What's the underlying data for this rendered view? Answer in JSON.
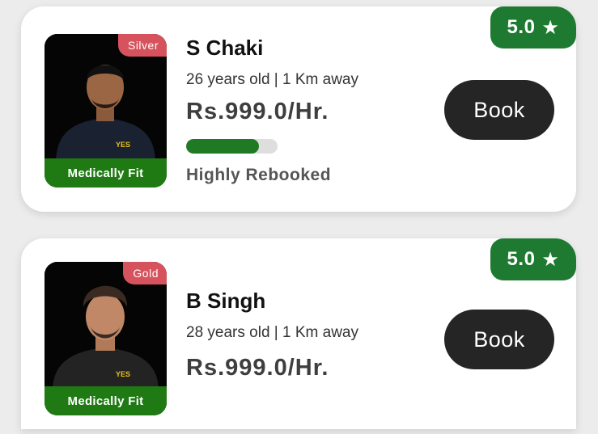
{
  "trainers": [
    {
      "rating": "5.0",
      "tier": "Silver",
      "health_badge": "Medically Fit",
      "name": "S Chaki",
      "meta": "26 years old | 1 Km away",
      "price": "Rs.999.0/Hr.",
      "rebook_progress": 0.8,
      "rebook_label": "Highly Rebooked",
      "book_label": "Book",
      "shirt_text": "YES"
    },
    {
      "rating": "5.0",
      "tier": "Gold",
      "health_badge": "Medically Fit",
      "name": "B Singh",
      "meta": "28 years old | 1 Km away",
      "price": "Rs.999.0/Hr.",
      "book_label": "Book",
      "shirt_text": "YES"
    }
  ],
  "icons": {
    "rating": "star-icon"
  },
  "colors": {
    "green": "#1f7a31",
    "tier_red": "#d6535d",
    "button": "#252525"
  }
}
